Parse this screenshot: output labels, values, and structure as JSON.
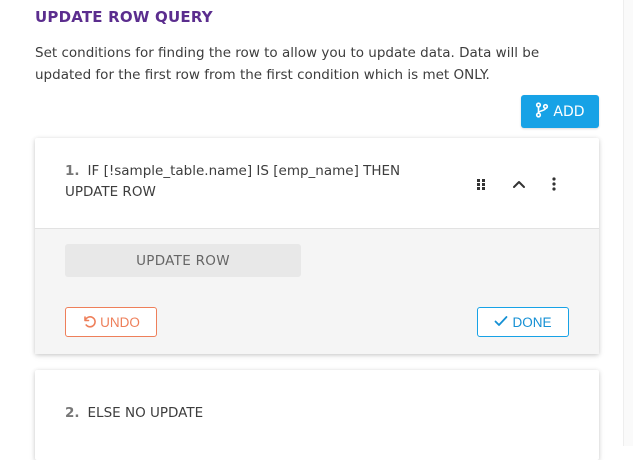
{
  "header": {
    "title": "UPDATE ROW QUERY",
    "description": "Set conditions for finding the row to allow you to update data. Data will be updated for the first row from the first condition which is met ONLY."
  },
  "toolbar": {
    "add_label": "ADD",
    "add_icon": "branch-icon",
    "accent_color": "#17a2e6"
  },
  "conditions": [
    {
      "number": "1.",
      "text": "IF [!sample_table.name] IS [emp_name] THEN UPDATE ROW",
      "action": "UPDATE ROW",
      "undo_label": "UNDO",
      "done_label": "DONE",
      "icons": [
        "drag-handle-icon",
        "chevron-up-icon",
        "more-vertical-icon"
      ]
    },
    {
      "number": "2.",
      "text": "ELSE NO UPDATE"
    }
  ],
  "colors": {
    "title": "#5b2d8e",
    "undo": "#ee7f5a",
    "done": "#17a2e6"
  }
}
